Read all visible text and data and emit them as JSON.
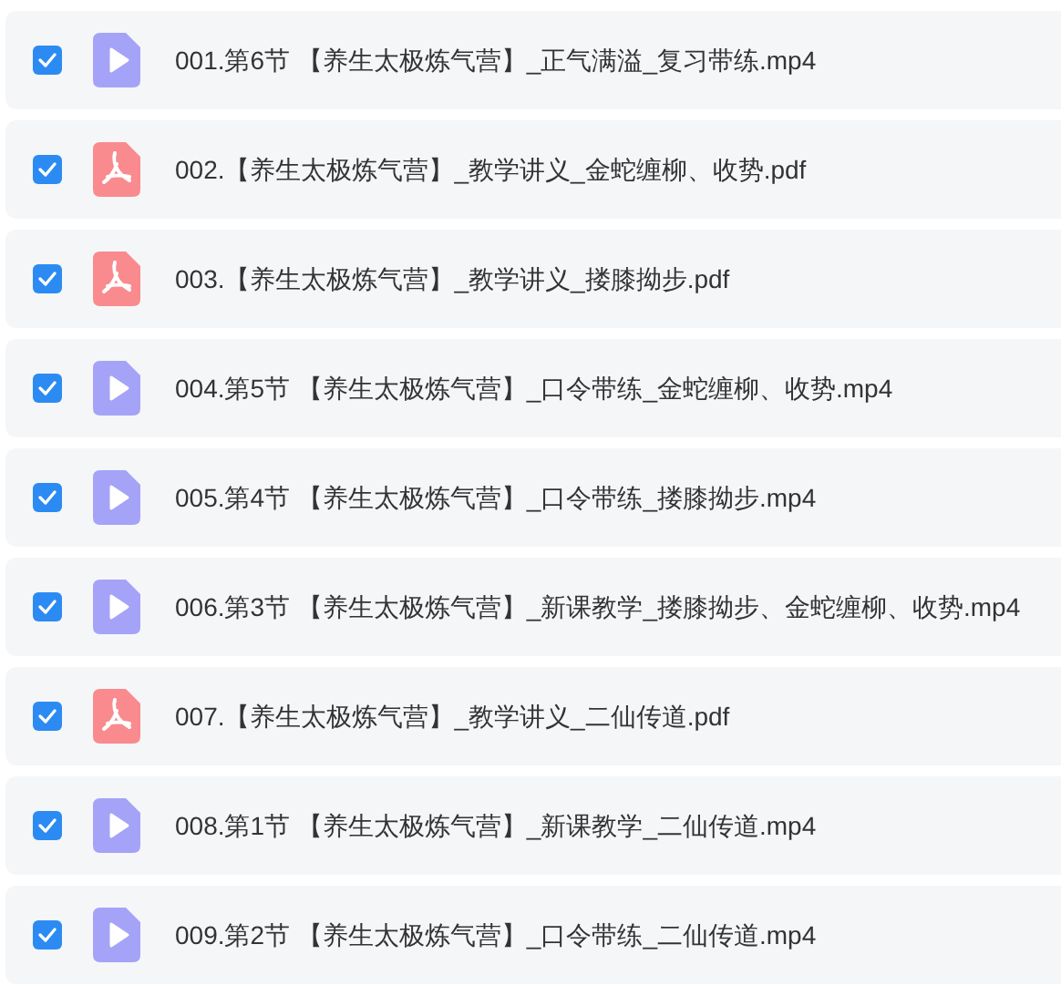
{
  "files": [
    {
      "name": "001.第6节 【养生太极炼气营】_正气满溢_复习带练.mp4",
      "kind": "video",
      "checked": true
    },
    {
      "name": "002.【养生太极炼气营】_教学讲义_金蛇缠柳、收势.pdf",
      "kind": "pdf",
      "checked": true
    },
    {
      "name": "003.【养生太极炼气营】_教学讲义_搂膝拗步.pdf",
      "kind": "pdf",
      "checked": true
    },
    {
      "name": "004.第5节 【养生太极炼气营】_口令带练_金蛇缠柳、收势.mp4",
      "kind": "video",
      "checked": true
    },
    {
      "name": "005.第4节 【养生太极炼气营】_口令带练_搂膝拗步.mp4",
      "kind": "video",
      "checked": true
    },
    {
      "name": "006.第3节 【养生太极炼气营】_新课教学_搂膝拗步、金蛇缠柳、收势.mp4",
      "kind": "video",
      "checked": true
    },
    {
      "name": "007.【养生太极炼气营】_教学讲义_二仙传道.pdf",
      "kind": "pdf",
      "checked": true
    },
    {
      "name": "008.第1节 【养生太极炼气营】_新课教学_二仙传道.mp4",
      "kind": "video",
      "checked": true
    },
    {
      "name": "009.第2节 【养生太极炼气营】_口令带练_二仙传道.mp4",
      "kind": "video",
      "checked": true
    }
  ]
}
